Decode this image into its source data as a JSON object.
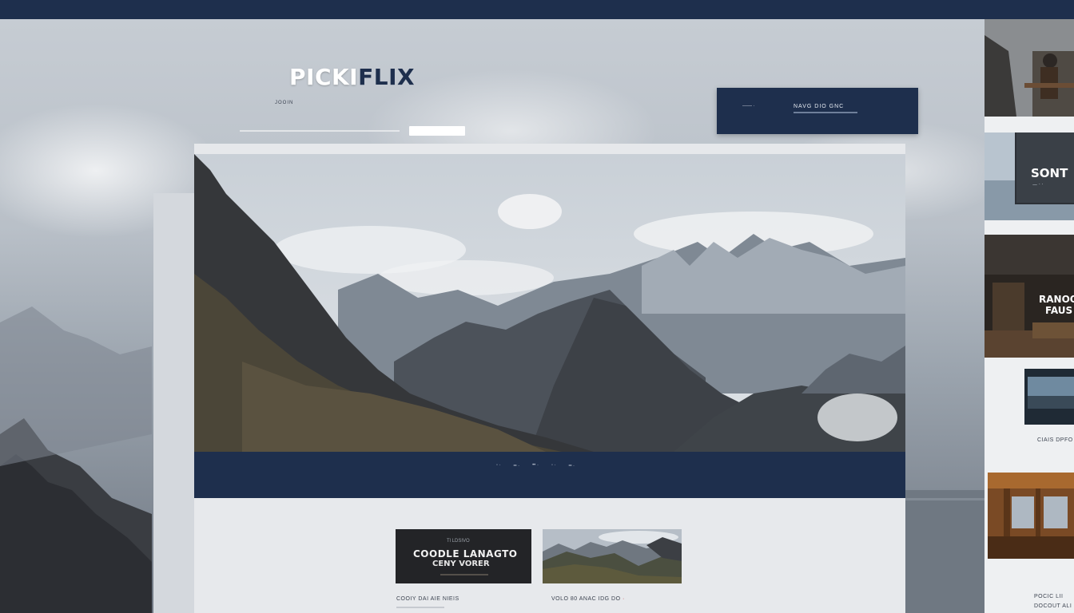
{
  "brand": {
    "logo_main": "PICKI",
    "logo_accent": "FLIX",
    "tagline": "JOOIN"
  },
  "cta": {
    "left_text": "—— ·",
    "right_text": "NAVG DIO GNC"
  },
  "hero_nav": [
    "◦ ·",
    "━ ·",
    "•• ·",
    "◦ ·",
    "━ ·"
  ],
  "cards": [
    {
      "kicker": "Tl LDSIVO",
      "title": "COODLE LANAGTO",
      "subtitle": "CENY VORER",
      "caption": "COOIY DAI AIE NIEIS"
    },
    {
      "caption": "VOLO 80 ANAC IDG",
      "caption_suffix": "DO",
      "caption_mark": "·"
    }
  ],
  "sidebar": [
    {
      "label": ""
    },
    {
      "label": "SONT",
      "sub": "— · ·"
    },
    {
      "label_line1": "RANOO",
      "label_line2": "FAUS"
    },
    {
      "caption": "CIAIS DPFO"
    },
    {
      "label": ""
    },
    {
      "caption_line1": "POCIC LII",
      "caption_line2": "DOCOUT ALI"
    }
  ],
  "colors": {
    "navy": "#1e2f4d",
    "panel": "#e6e8eb"
  }
}
